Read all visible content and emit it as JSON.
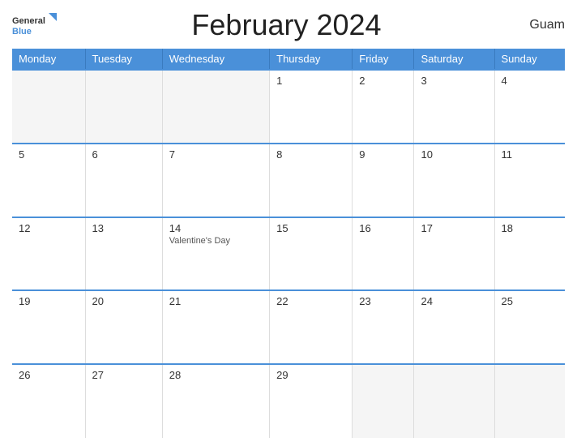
{
  "header": {
    "title": "February 2024",
    "region": "Guam",
    "logo_general": "General",
    "logo_blue": "Blue"
  },
  "days_of_week": [
    "Monday",
    "Tuesday",
    "Wednesday",
    "Thursday",
    "Friday",
    "Saturday",
    "Sunday"
  ],
  "weeks": [
    [
      {
        "day": "",
        "empty": true
      },
      {
        "day": "",
        "empty": true
      },
      {
        "day": "",
        "empty": true
      },
      {
        "day": "1",
        "empty": false
      },
      {
        "day": "2",
        "empty": false
      },
      {
        "day": "3",
        "empty": false
      },
      {
        "day": "4",
        "empty": false
      }
    ],
    [
      {
        "day": "5",
        "empty": false
      },
      {
        "day": "6",
        "empty": false
      },
      {
        "day": "7",
        "empty": false
      },
      {
        "day": "8",
        "empty": false
      },
      {
        "day": "9",
        "empty": false
      },
      {
        "day": "10",
        "empty": false
      },
      {
        "day": "11",
        "empty": false
      }
    ],
    [
      {
        "day": "12",
        "empty": false
      },
      {
        "day": "13",
        "empty": false
      },
      {
        "day": "14",
        "empty": false,
        "event": "Valentine's Day"
      },
      {
        "day": "15",
        "empty": false
      },
      {
        "day": "16",
        "empty": false
      },
      {
        "day": "17",
        "empty": false
      },
      {
        "day": "18",
        "empty": false
      }
    ],
    [
      {
        "day": "19",
        "empty": false
      },
      {
        "day": "20",
        "empty": false
      },
      {
        "day": "21",
        "empty": false
      },
      {
        "day": "22",
        "empty": false
      },
      {
        "day": "23",
        "empty": false
      },
      {
        "day": "24",
        "empty": false
      },
      {
        "day": "25",
        "empty": false
      }
    ],
    [
      {
        "day": "26",
        "empty": false
      },
      {
        "day": "27",
        "empty": false
      },
      {
        "day": "28",
        "empty": false
      },
      {
        "day": "29",
        "empty": false
      },
      {
        "day": "",
        "empty": true
      },
      {
        "day": "",
        "empty": true
      },
      {
        "day": "",
        "empty": true
      }
    ]
  ]
}
